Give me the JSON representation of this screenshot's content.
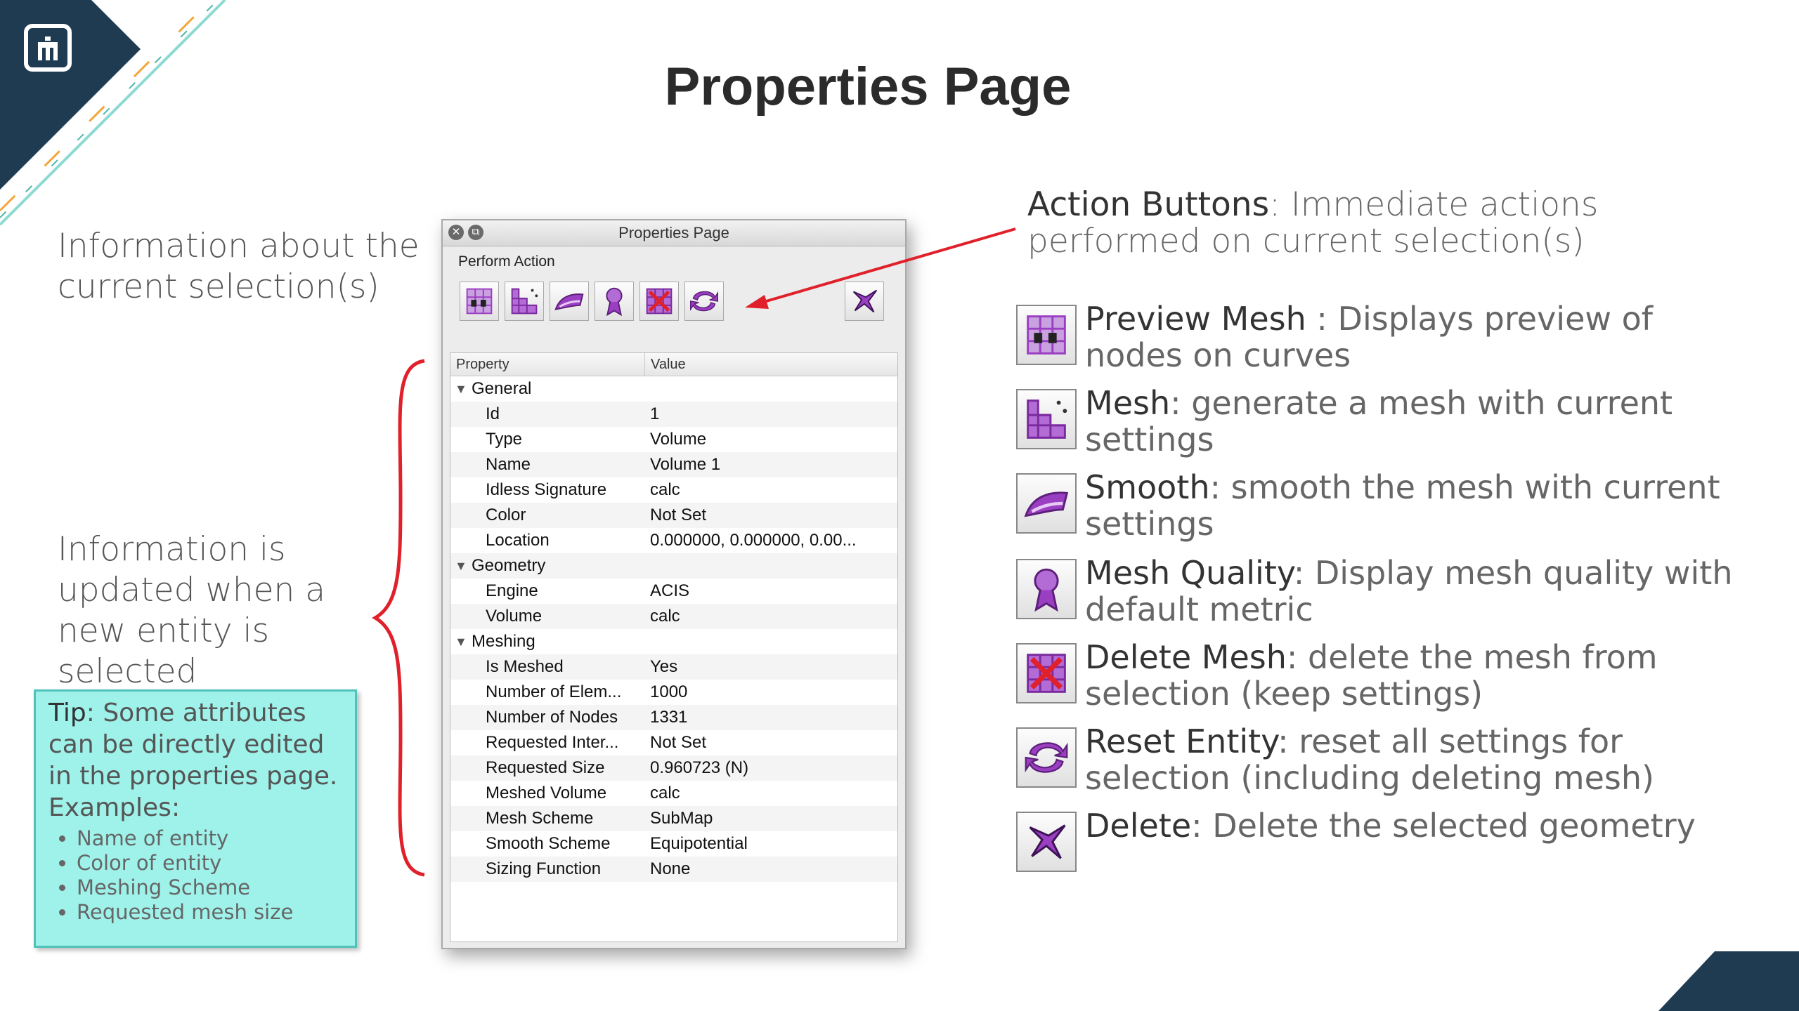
{
  "slide": {
    "title": "Properties Page",
    "selection_info": "Information about the current selection(s)",
    "update_info": "Information is updated when a new entity is selected",
    "tip": {
      "label": "Tip",
      "text": ": Some attributes can be directly edited in the properties page. Examples:",
      "examples": [
        "Name of entity",
        "Color of entity",
        "Meshing Scheme",
        "Requested mesh size"
      ]
    }
  },
  "dialog": {
    "title": "Properties Page",
    "perform_action": "Perform Action",
    "close_glyph": "✕",
    "restore_glyph": "⧉",
    "headers": {
      "property": "Property",
      "value": "Value"
    },
    "groups": [
      {
        "name": "General",
        "rows": [
          {
            "p": "Id",
            "v": "1"
          },
          {
            "p": "Type",
            "v": "Volume"
          },
          {
            "p": "Name",
            "v": "Volume 1"
          },
          {
            "p": "Idless Signature",
            "v": "calc"
          },
          {
            "p": "Color",
            "v": "Not Set"
          },
          {
            "p": "Location",
            "v": "0.000000, 0.000000, 0.00..."
          }
        ]
      },
      {
        "name": "Geometry",
        "rows": [
          {
            "p": "Engine",
            "v": "ACIS"
          },
          {
            "p": "Volume",
            "v": "calc"
          }
        ]
      },
      {
        "name": "Meshing",
        "rows": [
          {
            "p": "Is Meshed",
            "v": "Yes"
          },
          {
            "p": "Number of Elem...",
            "v": "1000"
          },
          {
            "p": "Number of Nodes",
            "v": "1331"
          },
          {
            "p": "Requested Inter...",
            "v": "Not Set"
          },
          {
            "p": "Requested Size",
            "v": "0.960723 (N)"
          },
          {
            "p": "Meshed Volume",
            "v": "calc"
          },
          {
            "p": "Mesh Scheme",
            "v": "SubMap"
          },
          {
            "p": "Smooth Scheme",
            "v": "Equipotential"
          },
          {
            "p": "Sizing Function",
            "v": "None"
          }
        ]
      }
    ]
  },
  "legend": {
    "title_bold": "Action Buttons",
    "title_rest": ": Immediate actions performed on current selection(s)",
    "items": [
      {
        "name": "Preview Mesh",
        "desc": " : Displays preview of nodes on curves",
        "icon": "preview-mesh-icon"
      },
      {
        "name": "Mesh",
        "desc": ": generate a mesh with current settings",
        "icon": "mesh-icon"
      },
      {
        "name": "Smooth",
        "desc": ": smooth the mesh with current settings",
        "icon": "smooth-icon"
      },
      {
        "name": "Mesh Quality",
        "desc": ": Display mesh quality with default metric",
        "icon": "mesh-quality-icon"
      },
      {
        "name": "Delete Mesh",
        "desc": ": delete the mesh from selection (keep settings)",
        "icon": "delete-mesh-icon"
      },
      {
        "name": "Reset Entity",
        "desc": ": reset all settings for selection (including deleting mesh)",
        "icon": "reset-entity-icon"
      },
      {
        "name": "Delete",
        "desc": ": Delete the selected geometry",
        "icon": "delete-icon"
      }
    ]
  },
  "colors": {
    "accent_purple": "#9b3fc2",
    "tip_bg": "#9ef2ea",
    "arrow_red": "#e0202a",
    "corner_navy": "#1f3b52"
  }
}
